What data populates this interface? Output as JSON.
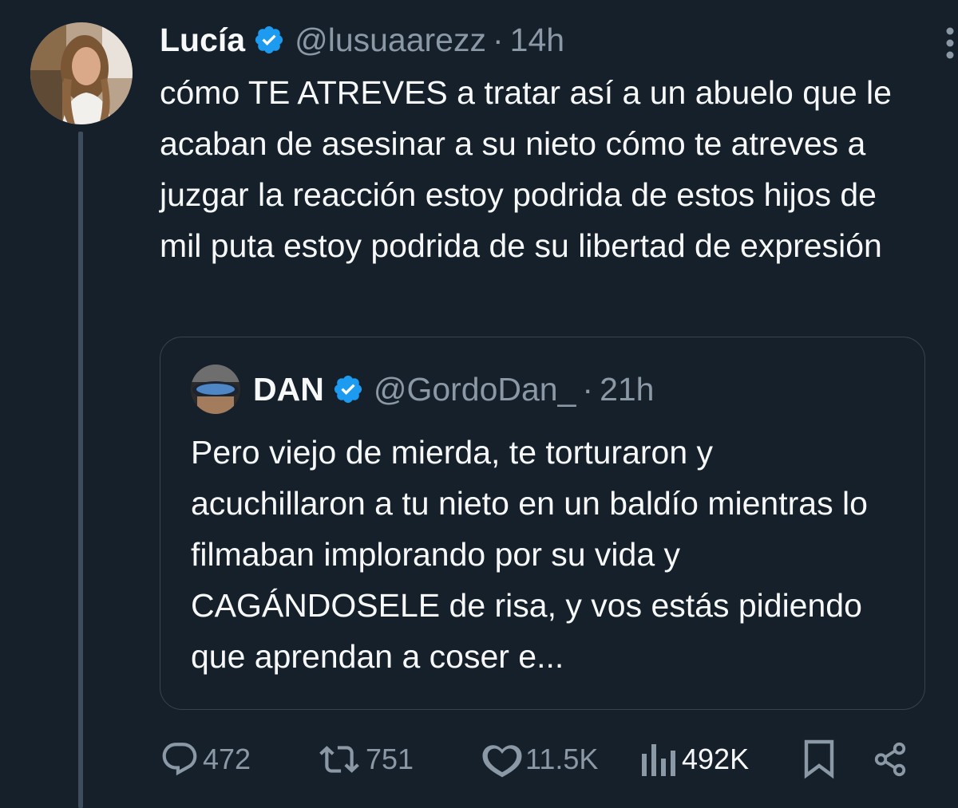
{
  "tweet": {
    "display_name": "Lucía",
    "handle": "@lusuaarezz",
    "separator": "·",
    "time": "14h",
    "text": "cómo TE ATREVES a tratar así a un abuelo que le acaban de asesinar a su nieto cómo te atreves a juzgar la reacción estoy podrida de estos hijos de mil puta estoy podrida de su libertad de expresión"
  },
  "quote": {
    "display_name": "DAN",
    "handle": "@GordoDan_",
    "separator": "·",
    "time": "21h",
    "text": "Pero viejo de mierda, te torturaron y acuchillaron a tu nieto en un baldío mientras lo filmaban implorando por su vida y CAGÁNDOSELE de risa, y vos estás pidiendo que aprendan a coser e..."
  },
  "actions": {
    "replies": "472",
    "retweets": "751",
    "likes": "11.5K",
    "views": "492K"
  },
  "icons": {
    "verified": "verified-badge-icon",
    "more": "more-vertical-icon",
    "reply": "reply-icon",
    "retweet": "retweet-icon",
    "like": "heart-icon",
    "views": "views-bar-chart-icon",
    "bookmark": "bookmark-icon",
    "share": "share-icon"
  },
  "colors": {
    "background": "#15202b",
    "verified": "#1d9bf0",
    "secondary_text": "#8b98a5",
    "border": "#38444d"
  }
}
